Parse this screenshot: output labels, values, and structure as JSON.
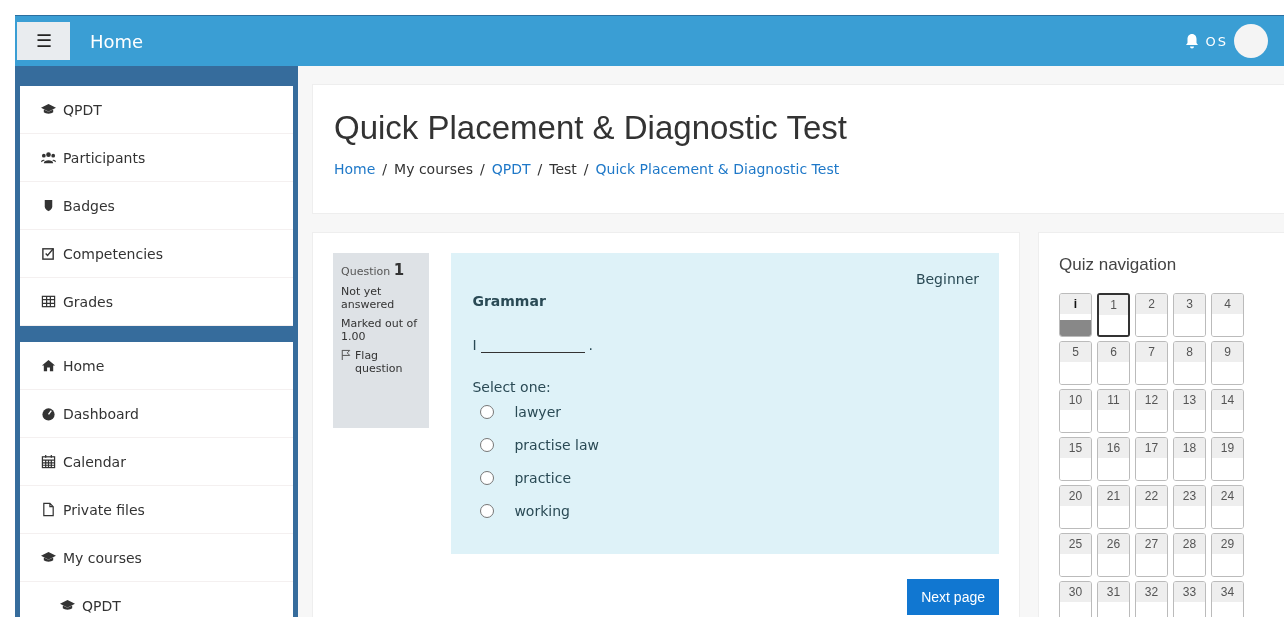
{
  "navbar": {
    "menu_icon": "☰",
    "title": "Home",
    "user_initials": "OS"
  },
  "sidebar": {
    "course_items": [
      {
        "label": "QPDT",
        "kind": "cap"
      },
      {
        "label": "Participants",
        "kind": "users"
      },
      {
        "label": "Badges",
        "kind": "shield"
      },
      {
        "label": "Competencies",
        "kind": "check"
      },
      {
        "label": "Grades",
        "kind": "table"
      }
    ],
    "site_items": [
      {
        "label": "Home",
        "kind": "home"
      },
      {
        "label": "Dashboard",
        "kind": "gauge"
      },
      {
        "label": "Calendar",
        "kind": "calendar"
      },
      {
        "label": "Private files",
        "kind": "file"
      },
      {
        "label": "My courses",
        "kind": "cap",
        "children": [
          {
            "label": "QPDT",
            "kind": "cap"
          }
        ]
      }
    ]
  },
  "header": {
    "title": "Quick Placement & Diagnostic Test",
    "breadcrumb": [
      {
        "label": "Home",
        "link": true,
        "separator": "/"
      },
      {
        "label": "My courses",
        "link": false,
        "separator": "/"
      },
      {
        "label": "QPDT",
        "link": true,
        "separator": "/"
      },
      {
        "label": "Test",
        "link": false,
        "separator": "/"
      },
      {
        "label": "Quick Placement & Diagnostic Test",
        "link": true
      }
    ]
  },
  "question": {
    "info": {
      "question_label": "Question",
      "number": "1",
      "status": "Not yet answered",
      "marks": "Marked out of 1.00",
      "flag": "Flag question"
    },
    "category": "Beginner",
    "heading": "Grammar",
    "prompt_start": "I",
    "prompt_end": ".",
    "select_label": "Select one:",
    "options": [
      {
        "label": "lawyer",
        "selected": false
      },
      {
        "label": "practise law",
        "selected": false
      },
      {
        "label": "practice",
        "selected": false
      },
      {
        "label": "working",
        "selected": false
      }
    ],
    "next_button": "Next page"
  },
  "quiz_navigation": {
    "title": "Quiz navigation",
    "buttons": [
      {
        "label": "i",
        "kind": "info",
        "selected": false
      },
      {
        "label": "1",
        "kind": "question",
        "selected": true
      },
      {
        "label": "2",
        "kind": "question",
        "selected": false
      },
      {
        "label": "3",
        "kind": "question",
        "selected": false
      },
      {
        "label": "4",
        "kind": "question",
        "selected": false
      },
      {
        "label": "5",
        "kind": "question",
        "selected": false
      },
      {
        "label": "6",
        "kind": "question",
        "selected": false
      },
      {
        "label": "7",
        "kind": "question",
        "selected": false
      },
      {
        "label": "8",
        "kind": "question",
        "selected": false
      },
      {
        "label": "9",
        "kind": "question",
        "selected": false
      },
      {
        "label": "10",
        "kind": "question",
        "selected": false
      },
      {
        "label": "11",
        "kind": "question",
        "selected": false
      },
      {
        "label": "12",
        "kind": "question",
        "selected": false
      },
      {
        "label": "13",
        "kind": "question",
        "selected": false
      },
      {
        "label": "14",
        "kind": "question",
        "selected": false
      },
      {
        "label": "15",
        "kind": "question",
        "selected": false
      },
      {
        "label": "16",
        "kind": "question",
        "selected": false
      },
      {
        "label": "17",
        "kind": "question",
        "selected": false
      },
      {
        "label": "18",
        "kind": "question",
        "selected": false
      },
      {
        "label": "19",
        "kind": "question",
        "selected": false
      },
      {
        "label": "20",
        "kind": "question",
        "selected": false
      },
      {
        "label": "21",
        "kind": "question",
        "selected": false
      },
      {
        "label": "22",
        "kind": "question",
        "selected": false
      },
      {
        "label": "23",
        "kind": "question",
        "selected": false
      },
      {
        "label": "24",
        "kind": "question",
        "selected": false
      },
      {
        "label": "25",
        "kind": "question",
        "selected": false
      },
      {
        "label": "26",
        "kind": "question",
        "selected": false
      },
      {
        "label": "27",
        "kind": "question",
        "selected": false
      },
      {
        "label": "28",
        "kind": "question",
        "selected": false
      },
      {
        "label": "29",
        "kind": "question",
        "selected": false
      },
      {
        "label": "30",
        "kind": "question",
        "selected": false
      },
      {
        "label": "31",
        "kind": "question",
        "selected": false
      },
      {
        "label": "32",
        "kind": "question",
        "selected": false
      },
      {
        "label": "33",
        "kind": "question",
        "selected": false
      },
      {
        "label": "34",
        "kind": "question",
        "selected": false
      }
    ]
  }
}
